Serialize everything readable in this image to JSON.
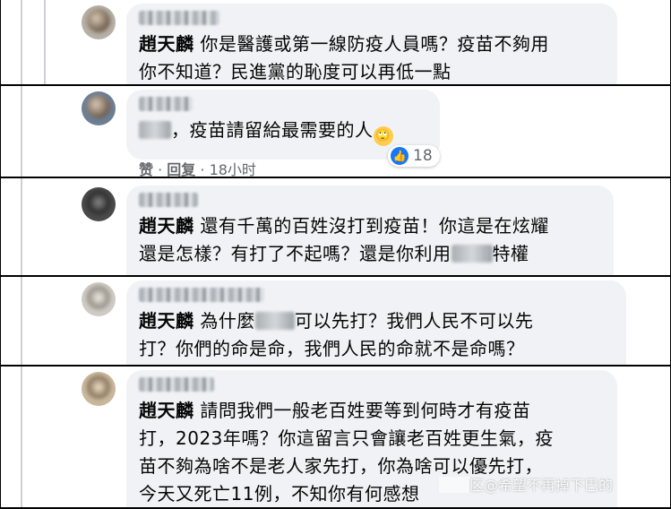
{
  "comments": [
    {
      "lines": [
        {
          "mention": "趙天麟",
          "text": "你是醫護或第一線防疫人員嗎？疫苗不夠用"
        },
        {
          "text": "你不知道？民進黨的恥度可以再低一點"
        }
      ]
    },
    {
      "lines": [
        {
          "pre": "",
          "text": "，疫苗請留給最需要的人"
        }
      ],
      "emoji": "🙄",
      "actions": {
        "like": "赞",
        "reply": "回复",
        "time": "18小时"
      },
      "reaction_count": "18"
    },
    {
      "lines": [
        {
          "mention": "趙天麟",
          "text": "還有千萬的百姓沒打到疫苗！你這是在炫耀"
        },
        {
          "text_before": "還是怎樣？有打了不起嗎？還是你利用",
          "text_after": "特權"
        }
      ]
    },
    {
      "lines": [
        {
          "mention": "趙天麟",
          "text_before": "為什麼",
          "text_after": "可以先打？我們人民不可以先"
        },
        {
          "text": "打？你們的命是命，我們人民的命就不是命嗎？"
        }
      ]
    },
    {
      "lines": [
        {
          "mention": "趙天麟",
          "text": "請問我們一般老百姓要等到何時才有疫苗"
        },
        {
          "text": "打，2023年嗎？你這留言只會讓老百姓更生氣，疫"
        },
        {
          "text": "苗不夠為啥不是老人家先打，你為啥可以優先打，"
        },
        {
          "text": "今天又死亡11例，不知你有何感想"
        }
      ]
    }
  ],
  "watermark": "区@希望不再掉下巴的"
}
